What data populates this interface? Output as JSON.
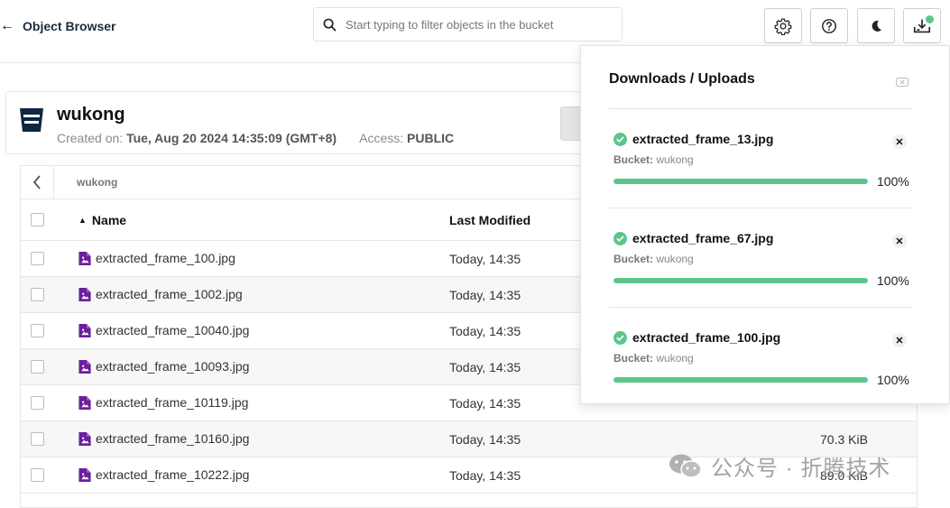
{
  "header": {
    "back_label": "Object Browser",
    "search_placeholder": "Start typing to filter objects in the bucket"
  },
  "bucket": {
    "name": "wukong",
    "created_label": "Created on:",
    "created_value": "Tue, Aug 20 2024 14:35:09 (GMT+8)",
    "access_label": "Access:",
    "access_value": "PUBLIC"
  },
  "browser": {
    "path": "wukong",
    "columns": {
      "name": "Name",
      "modified": "Last Modified"
    },
    "rows": [
      {
        "name": "extracted_frame_100.jpg",
        "modified": "Today, 14:35",
        "size": ""
      },
      {
        "name": "extracted_frame_1002.jpg",
        "modified": "Today, 14:35",
        "size": ""
      },
      {
        "name": "extracted_frame_10040.jpg",
        "modified": "Today, 14:35",
        "size": ""
      },
      {
        "name": "extracted_frame_10093.jpg",
        "modified": "Today, 14:35",
        "size": ""
      },
      {
        "name": "extracted_frame_10119.jpg",
        "modified": "Today, 14:35",
        "size": ""
      },
      {
        "name": "extracted_frame_10160.jpg",
        "modified": "Today, 14:35",
        "size": "70.3 KiB"
      },
      {
        "name": "extracted_frame_10222.jpg",
        "modified": "Today, 14:35",
        "size": "89.0 KiB"
      }
    ]
  },
  "panel": {
    "title": "Downloads / Uploads",
    "items": [
      {
        "name": "extracted_frame_13.jpg",
        "bucket_label": "Bucket:",
        "bucket": "wukong",
        "percent_text": "100%",
        "progress": 1.0
      },
      {
        "name": "extracted_frame_67.jpg",
        "bucket_label": "Bucket:",
        "bucket": "wukong",
        "percent_text": "100%",
        "progress": 1.0
      },
      {
        "name": "extracted_frame_100.jpg",
        "bucket_label": "Bucket:",
        "bucket": "wukong",
        "percent_text": "100%",
        "progress": 1.0
      }
    ]
  },
  "watermark": {
    "text": "公众号 · 折腾技术"
  },
  "icons": {
    "back": "arrow-left-icon",
    "search": "search-icon",
    "settings": "gear-icon",
    "help": "help-circle-icon",
    "theme": "moon-icon",
    "transfers": "download-tray-icon",
    "bucket": "bucket-icon",
    "file": "image-file-icon",
    "done": "check-circle-icon",
    "close": "close-icon"
  },
  "colors": {
    "progress": "#5bc68b",
    "file_icon": "#6b1f9b",
    "notification_dot": "#5bc68b"
  }
}
